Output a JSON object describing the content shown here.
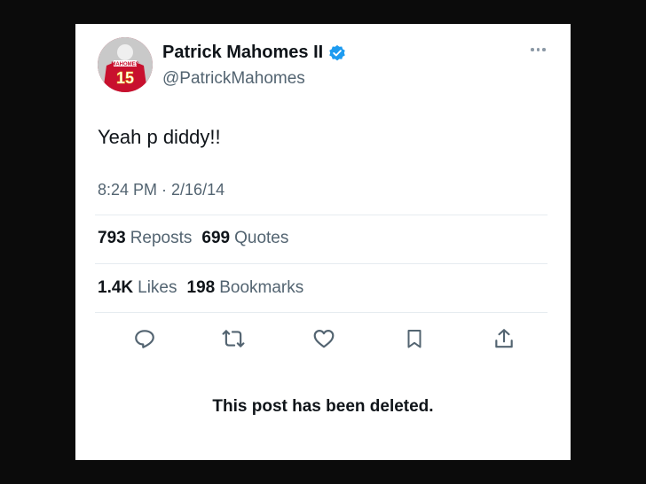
{
  "post": {
    "author": {
      "name": "Patrick Mahomes II",
      "handle": "@PatrickMahomes",
      "verified": true,
      "avatar_jersey_text": "MAHOMES",
      "avatar_jersey_number": "15"
    },
    "text": "Yeah p diddy!!",
    "timestamp": "8:24 PM · 2/16/14",
    "stats": {
      "reposts": {
        "count": "793",
        "label": "Reposts"
      },
      "quotes": {
        "count": "699",
        "label": "Quotes"
      },
      "likes": {
        "count": "1.4K",
        "label": "Likes"
      },
      "bookmarks": {
        "count": "198",
        "label": "Bookmarks"
      }
    },
    "status_message": "This post has been deleted."
  },
  "actions": [
    {
      "icon": "reply-icon"
    },
    {
      "icon": "repost-icon"
    },
    {
      "icon": "like-icon"
    },
    {
      "icon": "bookmark-icon"
    },
    {
      "icon": "share-icon"
    }
  ],
  "colors": {
    "background": "#0b0b0b",
    "card": "#ffffff",
    "text_primary": "#0f1419",
    "text_secondary": "#536471",
    "verified_blue": "#1d9bf0",
    "divider": "#e6ecf0"
  }
}
